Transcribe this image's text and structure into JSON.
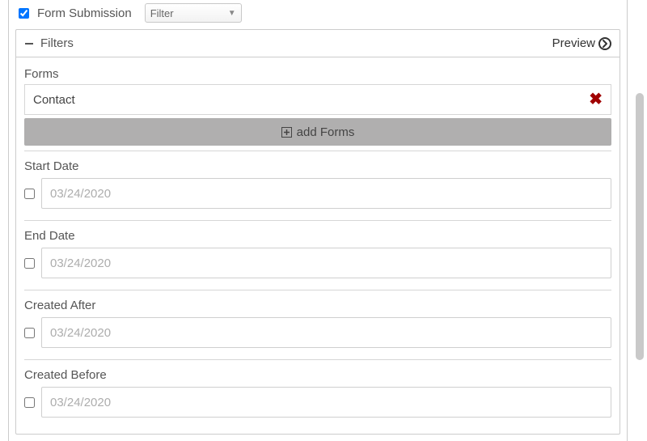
{
  "top": {
    "form_submission_label": "Form Submission",
    "form_submission_checked": true,
    "filter_dropdown_value": "Filter"
  },
  "filters": {
    "header_label": "Filters",
    "preview_label": "Preview"
  },
  "forms": {
    "section_label": "Forms",
    "items": [
      {
        "name": "Contact"
      }
    ],
    "add_button_label": "add Forms"
  },
  "date_fields": [
    {
      "label": "Start Date",
      "placeholder": "03/24/2020",
      "checked": false
    },
    {
      "label": "End Date",
      "placeholder": "03/24/2020",
      "checked": false
    },
    {
      "label": "Created After",
      "placeholder": "03/24/2020",
      "checked": false
    },
    {
      "label": "Created Before",
      "placeholder": "03/24/2020",
      "checked": false
    }
  ]
}
